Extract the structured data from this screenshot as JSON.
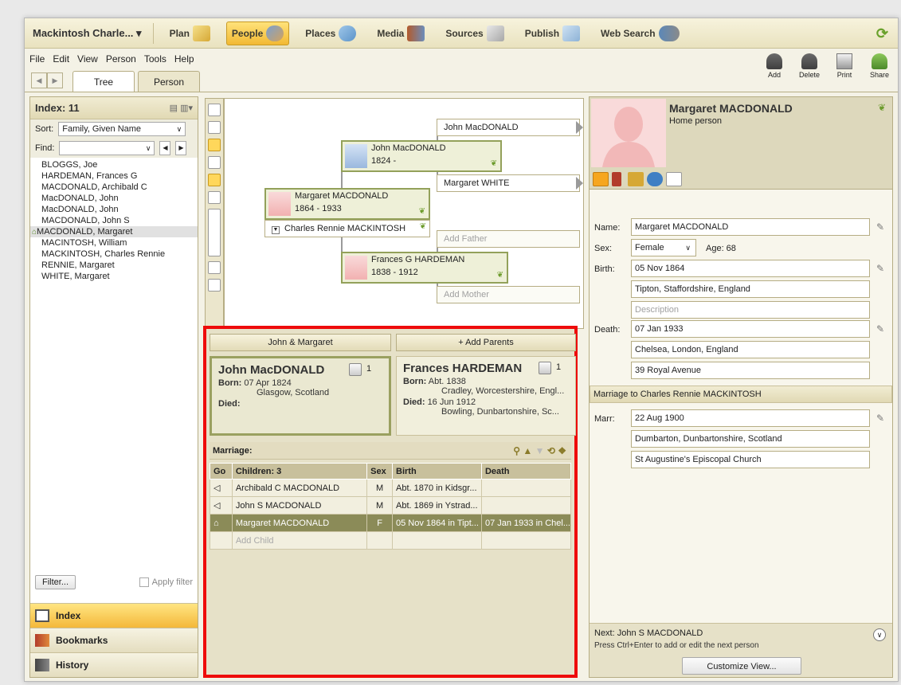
{
  "topnav": {
    "tree_name": "Mackintosh Charle...",
    "tree_arrow": "▾",
    "items": [
      {
        "label": "Plan"
      },
      {
        "label": "People"
      },
      {
        "label": "Places"
      },
      {
        "label": "Media"
      },
      {
        "label": "Sources"
      },
      {
        "label": "Publish"
      },
      {
        "label": "Web Search"
      }
    ],
    "active": "People"
  },
  "menubar": {
    "file": "File",
    "edit": "Edit",
    "view": "View",
    "person": "Person",
    "tools": "Tools",
    "help": "Help"
  },
  "tabs": {
    "tree": "Tree",
    "person": "Person"
  },
  "toolbar": {
    "add": "Add",
    "delete": "Delete",
    "print": "Print",
    "share": "Share"
  },
  "index": {
    "title": "Index: 11",
    "sort_label": "Sort:",
    "sort_value": "Family, Given Name",
    "find_label": "Find:",
    "find_value": "",
    "people": [
      "BLOGGS, Joe",
      "HARDEMAN, Frances G",
      "MACDONALD, Archibald C",
      "MacDONALD, John",
      "MacDONALD, John",
      "MACDONALD, John S",
      "MACDONALD, Margaret",
      "MACINTOSH, William",
      "MACKINTOSH, Charles Rennie",
      "RENNIE, Margaret",
      "WHITE, Margaret"
    ],
    "filter_button": "Filter...",
    "apply_filter": "Apply filter",
    "nav": {
      "index": "Index",
      "bookmarks": "Bookmarks",
      "history": "History"
    }
  },
  "pedigree": {
    "root": {
      "name": "Margaret MACDONALD",
      "dates": "1864 - 1933"
    },
    "spouse": "Charles Rennie MACKINTOSH",
    "father": {
      "name": "John MacDONALD",
      "dates": "1824 -"
    },
    "mother": {
      "name": "Frances G HARDEMAN",
      "dates": "1838 - 1912"
    },
    "gf": "John MacDONALD",
    "gm": "Margaret WHITE",
    "add_father": "Add Father",
    "add_mother": "Add Mother"
  },
  "family": {
    "left_head": "John & Margaret",
    "right_head": "+ Add Parents",
    "father": {
      "name": "John MacDONALD",
      "count": "1",
      "born_label": "Born:",
      "born_date": "07 Apr 1824",
      "born_place": "Glasgow, Scotland",
      "died_label": "Died:"
    },
    "mother": {
      "name": "Frances HARDEMAN",
      "count": "1",
      "born_label": "Born:",
      "born_date": "Abt. 1838",
      "born_place": "Cradley, Worcestershire, Engl...",
      "died_label": "Died:",
      "died_date": "16 Jun 1912",
      "died_place": "Bowling, Dunbartonshire, Sc..."
    },
    "marriage_label": "Marriage:",
    "columns": [
      "Go",
      "Children: 3",
      "Sex",
      "Birth",
      "Death"
    ],
    "children": [
      {
        "go": "◁",
        "name": "Archibald C MACDONALD",
        "sex": "M",
        "birth": "Abt. 1870 in Kidsgr...",
        "death": ""
      },
      {
        "go": "◁",
        "name": "John S MACDONALD",
        "sex": "M",
        "birth": "Abt. 1869 in Ystrad...",
        "death": ""
      },
      {
        "go": "⌂",
        "name": "Margaret MACDONALD",
        "sex": "F",
        "birth": "05 Nov 1864 in Tipt...",
        "death": "07 Jan 1933 in Chel..."
      }
    ],
    "add_child": "Add Child"
  },
  "person": {
    "name": "Margaret MACDONALD",
    "subtitle": "Home person",
    "name_label": "Name:",
    "name_value": "Margaret MACDONALD",
    "sex_label": "Sex:",
    "sex_value": "Female",
    "age": "Age: 68",
    "birth_label": "Birth:",
    "birth_date": "05 Nov 1864",
    "birth_place": "Tipton, Staffordshire, England",
    "birth_desc_placeholder": "Description",
    "death_label": "Death:",
    "death_date": "07 Jan 1933",
    "death_place": "Chelsea, London, England",
    "death_desc": "39 Royal Avenue",
    "marriage_header": "Marriage to Charles Rennie MACKINTOSH",
    "marr_label": "Marr:",
    "marr_date": "22 Aug 1900",
    "marr_place": "Dumbarton, Dunbartonshire, Scotland",
    "marr_desc": "St Augustine's Episcopal Church",
    "next_label": "Next:",
    "next_person": "John S MACDONALD",
    "next_hint": "Press Ctrl+Enter to add or edit the next person",
    "customize": "Customize View..."
  }
}
